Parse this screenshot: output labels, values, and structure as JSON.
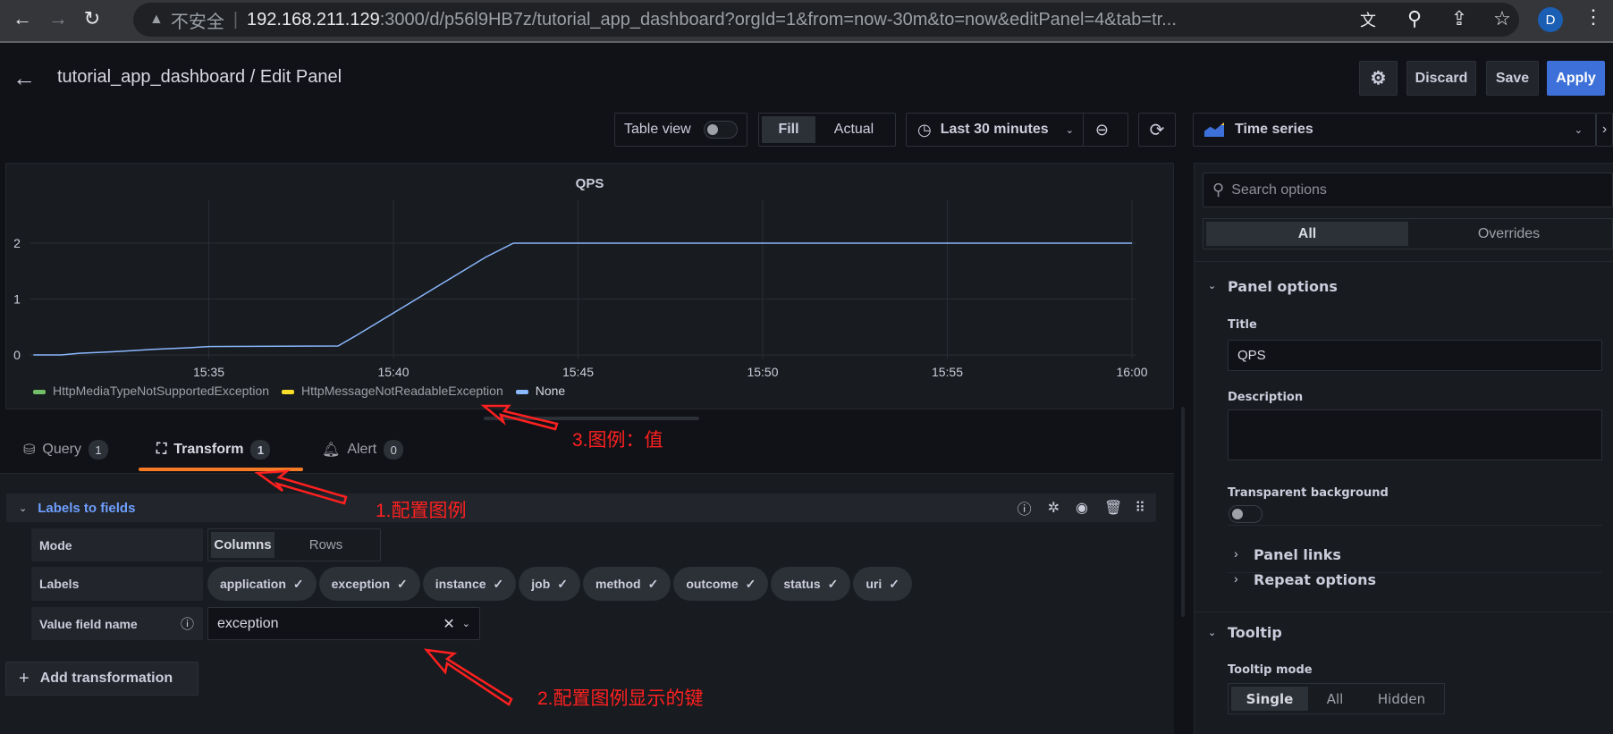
{
  "browser": {
    "security_label": "不安全",
    "url_host": "192.168.211.129",
    "url_rest": ":3000/d/p56l9HB7z/tutorial_app_dashboard?orgId=1&from=now-30m&to=now&editPanel=4&tab=tr...",
    "profile_initial": "D"
  },
  "header": {
    "title": "tutorial_app_dashboard / Edit Panel",
    "discard": "Discard",
    "save": "Save",
    "apply": "Apply"
  },
  "toolbar": {
    "table_view": "Table view",
    "fill": "Fill",
    "actual": "Actual",
    "time_range": "Last 30 minutes",
    "visualization": "Time series"
  },
  "panel": {
    "title": "QPS"
  },
  "chart_data": {
    "type": "line",
    "title": "QPS",
    "x_unit": "time (HH:MM)",
    "xlim": [
      "15:30",
      "16:00"
    ],
    "ylim": [
      0,
      2.2
    ],
    "x_ticks": [
      "15:35",
      "15:40",
      "15:45",
      "15:50",
      "15:55",
      "16:00"
    ],
    "y_ticks": [
      "0",
      "1",
      "2"
    ],
    "grid": true,
    "legend_placement": "bottom-left",
    "series": [
      {
        "name": "HttpMediaTypeNotSupportedException",
        "color": "#73bf69",
        "points": []
      },
      {
        "name": "HttpMessageNotReadableException",
        "color": "#fade2a",
        "points": []
      },
      {
        "name": "None",
        "color": "#8ab8ff",
        "points": [
          [
            "15:30:15",
            0
          ],
          [
            "15:31:00",
            0
          ],
          [
            "15:31:30",
            0.03
          ],
          [
            "15:32:30",
            0.06
          ],
          [
            "15:33:30",
            0.1
          ],
          [
            "15:34:30",
            0.13
          ],
          [
            "15:35:00",
            0.15
          ],
          [
            "15:38:30",
            0.16
          ],
          [
            "15:39:00",
            0.35
          ],
          [
            "15:39:30",
            0.55
          ],
          [
            "15:40:00",
            0.75
          ],
          [
            "15:40:30",
            0.95
          ],
          [
            "15:41:00",
            1.15
          ],
          [
            "15:41:30",
            1.35
          ],
          [
            "15:42:00",
            1.55
          ],
          [
            "15:42:30",
            1.75
          ],
          [
            "15:43:15",
            2.0
          ],
          [
            "16:00:00",
            2.0
          ]
        ]
      }
    ]
  },
  "tabs": [
    {
      "label": "Query",
      "count": "1"
    },
    {
      "label": "Transform",
      "count": "1"
    },
    {
      "label": "Alert",
      "count": "0"
    }
  ],
  "transform": {
    "name": "Labels to fields",
    "mode_label": "Mode",
    "modes": [
      "Columns",
      "Rows"
    ],
    "mode_selected": "Columns",
    "labels_label": "Labels",
    "labels": [
      "application",
      "exception",
      "instance",
      "job",
      "method",
      "outcome",
      "status",
      "uri"
    ],
    "value_field_label": "Value field name",
    "value_field_value": "exception",
    "add_button": "Add transformation"
  },
  "options": {
    "search_placeholder": "Search options",
    "tabs": [
      "All",
      "Overrides"
    ],
    "panel_options": "Panel options",
    "title_label": "Title",
    "title_value": "QPS",
    "description_label": "Description",
    "transparent_label": "Transparent background",
    "transparent": false,
    "panel_links": "Panel links",
    "repeat_options": "Repeat options",
    "tooltip": "Tooltip",
    "tooltip_mode_label": "Tooltip mode",
    "tooltip_modes": [
      "Single",
      "All",
      "Hidden"
    ],
    "tooltip_mode_selected": "Single"
  },
  "annotations": [
    "3.图例：值",
    "1.配置图例",
    "2.配置图例显示的键"
  ],
  "colors": {
    "accent": "#3d71d9",
    "tab_underline": "#f57b26",
    "annotation": "#ff2020",
    "link": "#6e9fff"
  }
}
